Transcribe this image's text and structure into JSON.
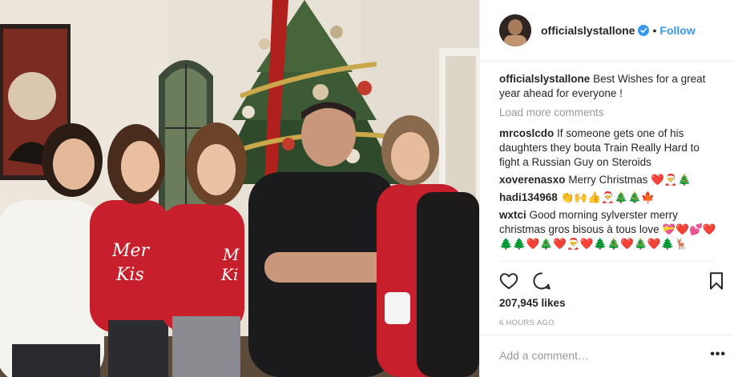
{
  "colors": {
    "accent": "#3897f0",
    "text": "#262626",
    "muted": "#999999",
    "divider": "#efefef"
  },
  "photo": {
    "subject": "family-christmas-tree-photo"
  },
  "header": {
    "username": "officialslystallone",
    "verified_icon": "verified-badge-icon",
    "separator": "•",
    "follow_label": "Follow"
  },
  "caption": {
    "username": "officialslystallone",
    "text": "Best Wishes for a great year ahead for everyone !"
  },
  "load_more_label": "Load more comments",
  "comments": [
    {
      "username": "mrcoslcdo",
      "text": "If someone gets one of his daughters they bouta Train Really Hard to fight a Russian Guy on Steroids"
    },
    {
      "username": "xoverenasxo",
      "text": "Merry Christmas ❤️🎅🎄"
    },
    {
      "username": "hadi134968",
      "text": "👏🙌👍🎅🎄🎄🍁"
    },
    {
      "username": "wxtci",
      "text": "Good morning sylverster merry christmas gros bisous à tous love 💝❤️💕❤️🌲🌲❤️🎄❤️🎅❤️🌲🎄❤️🎄❤️🌲🦌"
    }
  ],
  "actions": {
    "like_icon": "heart-icon",
    "comment_icon": "speech-bubble-icon",
    "save_icon": "bookmark-icon"
  },
  "likes": "207,945 likes",
  "timestamp": "6 HOURS AGO",
  "add_comment": {
    "placeholder": "Add a comment…",
    "more_label": "•••"
  }
}
